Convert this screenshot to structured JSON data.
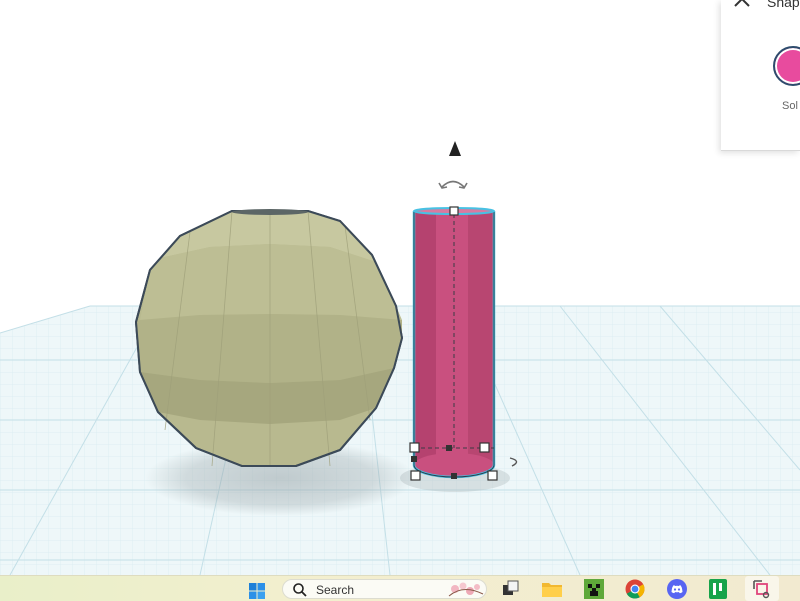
{
  "properties_panel": {
    "title": "Shap",
    "color_label": "Sol",
    "color": "#e84b9e",
    "close_icon": "close-icon"
  },
  "workplane": {
    "grid_color": "#c9e3ea",
    "shapes": [
      {
        "name": "sphere",
        "color": "#b8b98f"
      },
      {
        "name": "cylinder",
        "color": "#c9507f",
        "selected": true
      }
    ]
  },
  "taskbar": {
    "search_label": "Search",
    "apps": [
      "start-icon",
      "search-icon",
      "task-view-icon",
      "file-explorer-icon",
      "minecraft-icon",
      "chrome-icon",
      "discord-icon",
      "sheets-app-icon",
      "snipping-tool-icon"
    ]
  }
}
